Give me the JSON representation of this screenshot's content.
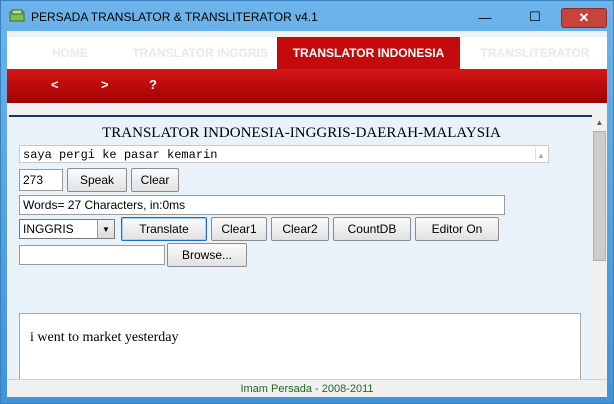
{
  "window": {
    "title": "PERSADA TRANSLATOR & TRANSLITERATOR v4.1",
    "minimize": "—",
    "maximize": "☐",
    "close": "✕"
  },
  "tabs": [
    {
      "label": "HOME"
    },
    {
      "label": "TRANSLATOR INGGRIS"
    },
    {
      "label": "TRANSLATOR INDONESIA"
    },
    {
      "label": "TRANSLITERATOR"
    }
  ],
  "nav": {
    "back": "<",
    "forward": ">",
    "help": "?"
  },
  "main": {
    "heading": "TRANSLATOR INDONESIA-INGGRIS-DAERAH-MALAYSIA",
    "input_text": "saya pergi ke pasar kemarin",
    "number_value": "273",
    "speak_label": "Speak",
    "clear_label": "Clear",
    "info_text": "Words= 27 Characters, in:0ms",
    "language_selected": "INGGRIS",
    "translate_label": "Translate",
    "clear1_label": "Clear1",
    "clear2_label": "Clear2",
    "countdb_label": "CountDB",
    "editor_label": "Editor On",
    "browse_label": "Browse...",
    "output_text": "i went to market yesterday"
  },
  "status": {
    "text": "Imam Persada - 2008-2011"
  },
  "colors": {
    "accent_red": "#c40a0a",
    "titlebar_blue": "#4a9be0",
    "status_green": "#1f6a1f"
  }
}
